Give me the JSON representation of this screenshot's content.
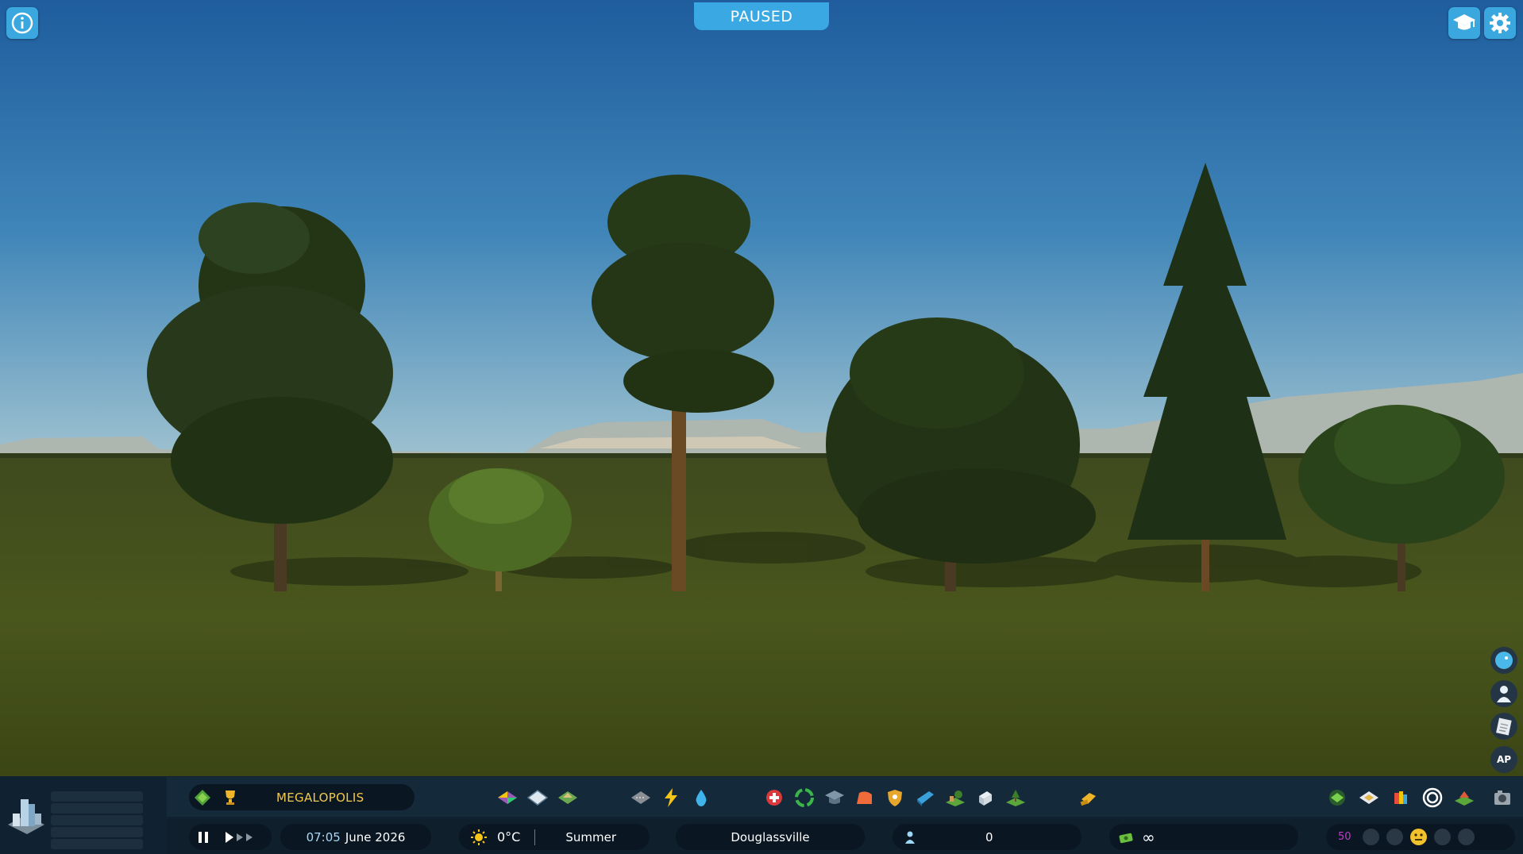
{
  "hud": {
    "paused_label": "PAUSED",
    "info_icon": "info-icon",
    "tutorial_icon": "graduation-cap-icon",
    "settings_icon": "gear-icon"
  },
  "side_panel": {
    "items": [
      {
        "name": "chirper-icon"
      },
      {
        "name": "citizen-icon"
      },
      {
        "name": "notes-icon"
      },
      {
        "name": "ap-label",
        "label": "AP"
      }
    ]
  },
  "toolbar": {
    "milestone_label": "MEGALOPOLIS",
    "icons": [
      "zoning-icon",
      "districts-icon",
      "landscaping-icon",
      "roads-icon",
      "electricity-icon",
      "water-icon",
      "healthcare-icon",
      "garbage-icon",
      "education-icon",
      "fire-icon",
      "police-icon",
      "transport-icon",
      "parks-icon",
      "unique-buildings-icon",
      "landscape-trees-icon",
      "bulldozer-icon",
      "money-icon",
      "budget-icon",
      "policies-icon",
      "target-icon",
      "park-areas-icon",
      "camera-icon"
    ]
  },
  "status": {
    "time": "07:05",
    "date": "June 2026",
    "temperature": "0°C",
    "season": "Summer",
    "city_name": "Douglassville",
    "population": "0",
    "money": "∞",
    "happiness": "50"
  },
  "colors": {
    "accent": "#3aa8e2",
    "milestone_text": "#f2c94c",
    "happiness_text": "#c23cc9",
    "time_text": "#a9d7f5"
  }
}
